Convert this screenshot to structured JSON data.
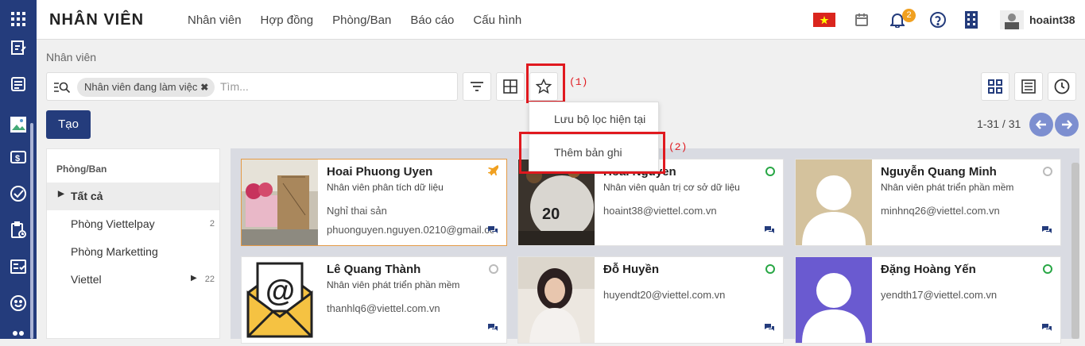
{
  "app": {
    "title": "NHÂN VIÊN",
    "menu": [
      "Nhân viên",
      "Hợp đồng",
      "Phòng/Ban",
      "Báo cáo",
      "Cấu hình"
    ]
  },
  "topbar": {
    "notification_count": "2",
    "username": "hoaint38"
  },
  "breadcrumb": "Nhân viên",
  "search": {
    "facet": "Nhân viên đang làm việc",
    "placeholder": "Tìm..."
  },
  "create_label": "Tạo",
  "pager": "1-31 / 31",
  "favorites_menu": {
    "items": [
      "Lưu bộ lọc hiện tại",
      "Thêm bản ghi"
    ]
  },
  "annotations": [
    "(1)",
    "(2)"
  ],
  "departments": {
    "title": "Phòng/Ban",
    "items": [
      {
        "label": "Tất cả",
        "count": ""
      },
      {
        "label": "Phòng Viettelpay",
        "count": "2"
      },
      {
        "label": "Phòng Marketting",
        "count": ""
      },
      {
        "label": "Viettel",
        "count": "22"
      }
    ]
  },
  "employees": [
    {
      "name": "Hoai Phuong Uyen",
      "job": "Nhân viên phân tích dữ liệu",
      "status": "Nghỉ thai sản",
      "email": "phuonguyen.nguyen.0210@gmail.com"
    },
    {
      "name": "Hoai Nguyen",
      "job": "Nhân viên quản trị cơ sở dữ liệu",
      "status": "",
      "email": "hoaint38@viettel.com.vn"
    },
    {
      "name": "Nguyễn Quang Minh",
      "job": "Nhân viên phát triển phần mềm",
      "status": "",
      "email": "minhnq26@viettel.com.vn"
    },
    {
      "name": "Lê Quang Thành",
      "job": "Nhân viên phát triển phần mềm",
      "status": "",
      "email": "thanhlq6@viettel.com.vn"
    },
    {
      "name": "Đỗ Huyền",
      "job": "",
      "status": "",
      "email": "huyendt20@viettel.com.vn"
    },
    {
      "name": "Đặng Hoàng Yến",
      "job": "",
      "status": "",
      "email": "yendth17@viettel.com.vn"
    }
  ],
  "colors": {
    "primary": "#243c7c",
    "annotation": "#e0191f",
    "online": "#28a745",
    "leave": "#f0a020"
  }
}
